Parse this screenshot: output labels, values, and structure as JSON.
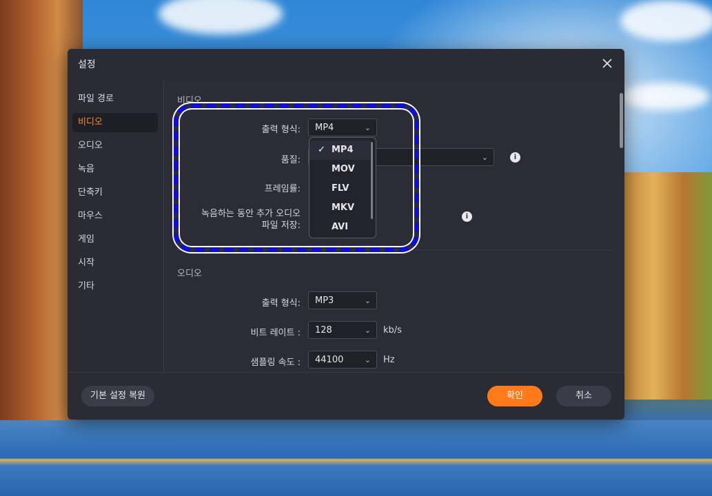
{
  "dialog": {
    "title": "설정"
  },
  "sidebar": {
    "items": [
      {
        "label": "파일 경로"
      },
      {
        "label": "비디오"
      },
      {
        "label": "오디오"
      },
      {
        "label": "녹음"
      },
      {
        "label": "단축키"
      },
      {
        "label": "마우스"
      },
      {
        "label": "게임"
      },
      {
        "label": "시작"
      },
      {
        "label": "기타"
      }
    ],
    "active": "비디오"
  },
  "video": {
    "section_label": "비디오",
    "output_format_label": "출력 형식:",
    "output_format_value": "MP4",
    "quality_label": "품질:",
    "framerate_label": "프레임률:",
    "extra_audio_label_line1": "녹음하는 동안 추가 오디오",
    "extra_audio_label_line2": "파일 저장:",
    "format_options": [
      "MP4",
      "MOV",
      "FLV",
      "MKV",
      "AVI"
    ],
    "selected_option": "MP4"
  },
  "audio": {
    "section_label": "오디오",
    "output_format_label": "출력 형식:",
    "output_format_value": "MP3",
    "bitrate_label": "비트 레이트 :",
    "bitrate_value": "128",
    "bitrate_unit": "kb/s",
    "samplerate_label": "샘플링 속도 :",
    "samplerate_value": "44100",
    "samplerate_unit": "Hz"
  },
  "footer": {
    "reset_label": "기본 설정 복원",
    "ok_label": "확인",
    "cancel_label": "취소"
  },
  "colors": {
    "accent": "#ff7a1a",
    "highlight_dashed": "#1111cc",
    "dialog_bg": "#2b2c36"
  },
  "icons": {
    "close": "close-icon",
    "info": "info-icon",
    "chevron": "chevron-down-icon",
    "check": "check-icon"
  }
}
